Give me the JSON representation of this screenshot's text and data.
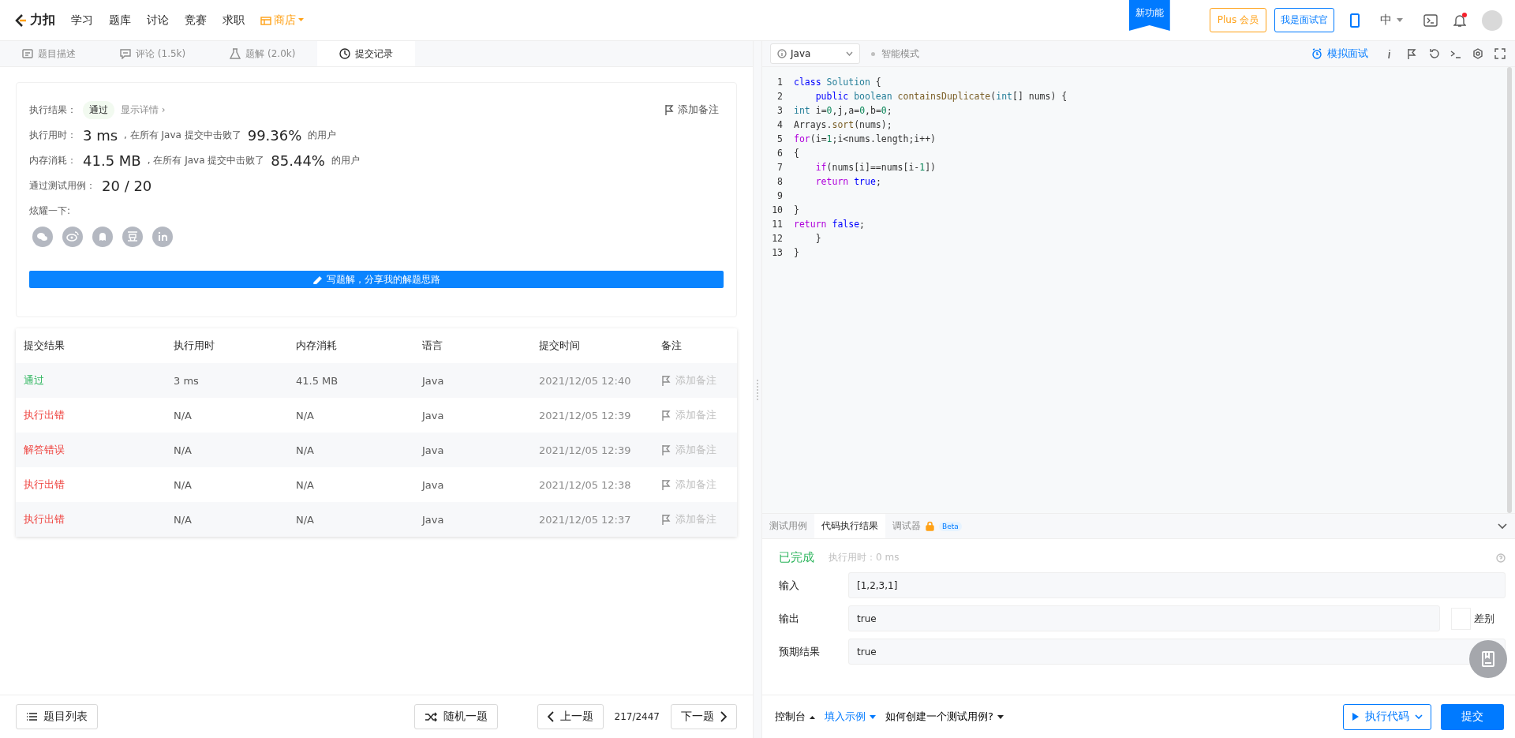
{
  "nav": {
    "logo": "力扣",
    "items": [
      {
        "label": "学习",
        "kind": "link"
      },
      {
        "label": "题库",
        "kind": "link"
      },
      {
        "label": "讨论",
        "kind": "link"
      },
      {
        "label": "竞赛",
        "kind": "link"
      },
      {
        "label": "求职",
        "kind": "link"
      },
      {
        "label": "商店",
        "kind": "shop"
      }
    ],
    "new_feature": "新功能",
    "plus": "Plus 会员",
    "interviewer": "我是面试官",
    "language": "中",
    "unread": true
  },
  "left_tabs": [
    {
      "label": "题目描述",
      "selected": false
    },
    {
      "label": "评论 (1.5k)",
      "selected": false
    },
    {
      "label": "题解 (2.0k)",
      "selected": false
    },
    {
      "label": "提交记录",
      "selected": true
    }
  ],
  "result": {
    "status_label": "执行结果：",
    "status": "通过",
    "details": "显示详情 ›",
    "add_note": "添加备注",
    "stats": [
      {
        "label": "执行用时：",
        "value": "3 ms",
        "text": ", 在所有 Java 提交中击败了",
        "percent": "99.36%",
        "suffix": "的用户"
      },
      {
        "label": "内存消耗：",
        "value": "41.5 MB",
        "text": ", 在所有 Java 提交中击败了",
        "percent": "85.44%",
        "suffix": "的用户"
      }
    ],
    "tests_label": "通过测试用例：",
    "tests": "20 / 20",
    "share_label": "炫耀一下:",
    "write_button": "写题解，分享我的解题思路"
  },
  "table": {
    "columns": [
      "提交结果",
      "执行用时",
      "内存消耗",
      "语言",
      "提交时间",
      "备注"
    ],
    "rows": [
      {
        "result": "通过",
        "kind": "accepted",
        "time": "3 ms",
        "memory": "41.5 MB",
        "language": "Java",
        "submitted": "2021/12/05 12:40",
        "note": "添加备注"
      },
      {
        "result": "执行出错",
        "kind": "error",
        "time": "N/A",
        "memory": "N/A",
        "language": "Java",
        "submitted": "2021/12/05 12:39",
        "note": "添加备注"
      },
      {
        "result": "解答错误",
        "kind": "error",
        "time": "N/A",
        "memory": "N/A",
        "language": "Java",
        "submitted": "2021/12/05 12:39",
        "note": "添加备注"
      },
      {
        "result": "执行出错",
        "kind": "error",
        "time": "N/A",
        "memory": "N/A",
        "language": "Java",
        "submitted": "2021/12/05 12:38",
        "note": "添加备注"
      },
      {
        "result": "执行出错",
        "kind": "error",
        "time": "N/A",
        "memory": "N/A",
        "language": "Java",
        "submitted": "2021/12/05 12:37",
        "note": "添加备注"
      }
    ]
  },
  "left_footer": {
    "list": "题目列表",
    "random": "随机一题",
    "prev": "上一题",
    "position": "217/2447",
    "next": "下一题"
  },
  "editor": {
    "language": "Java",
    "mode": "智能模式",
    "mock": "模拟面试",
    "lines": [
      {
        "number": "1",
        "tokens": [
          {
            "kind": "keyword",
            "text": "class"
          },
          {
            "kind": "type",
            "text": " Solution"
          },
          {
            "kind": "plain",
            "text": " {"
          }
        ]
      },
      {
        "number": "2",
        "tokens": [
          {
            "kind": "keyword",
            "text": "    public"
          },
          {
            "kind": "type",
            "text": " boolean"
          },
          {
            "kind": "func",
            "text": " containsDuplicate"
          },
          {
            "kind": "plain",
            "text": "("
          },
          {
            "kind": "type",
            "text": "int"
          },
          {
            "kind": "plain",
            "text": "[] nums) {"
          }
        ]
      },
      {
        "number": "3",
        "tokens": [
          {
            "kind": "type",
            "text": "int"
          },
          {
            "kind": "plain",
            "text": " i="
          },
          {
            "kind": "number",
            "text": "0"
          },
          {
            "kind": "plain",
            "text": ",j,a="
          },
          {
            "kind": "number",
            "text": "0"
          },
          {
            "kind": "plain",
            "text": ",b="
          },
          {
            "kind": "number",
            "text": "0"
          },
          {
            "kind": "plain",
            "text": ";"
          }
        ]
      },
      {
        "number": "4",
        "tokens": [
          {
            "kind": "plain",
            "text": "Arrays."
          },
          {
            "kind": "func",
            "text": "sort"
          },
          {
            "kind": "plain",
            "text": "(nums);"
          }
        ]
      },
      {
        "number": "5",
        "tokens": [
          {
            "kind": "control",
            "text": "for"
          },
          {
            "kind": "plain",
            "text": "(i="
          },
          {
            "kind": "number",
            "text": "1"
          },
          {
            "kind": "plain",
            "text": ";i<nums.length;i++)"
          }
        ]
      },
      {
        "number": "6",
        "tokens": [
          {
            "kind": "plain",
            "text": "{"
          }
        ]
      },
      {
        "number": "7",
        "tokens": [
          {
            "kind": "control",
            "text": "    if"
          },
          {
            "kind": "plain",
            "text": "(nums[i]==nums[i-"
          },
          {
            "kind": "number",
            "text": "1"
          },
          {
            "kind": "plain",
            "text": "])"
          }
        ]
      },
      {
        "number": "8",
        "tokens": [
          {
            "kind": "control",
            "text": "    return"
          },
          {
            "kind": "keyword",
            "text": " true"
          },
          {
            "kind": "plain",
            "text": ";"
          }
        ]
      },
      {
        "number": "9"
      },
      {
        "number": "10",
        "tokens": [
          {
            "kind": "plain",
            "text": "}"
          }
        ]
      },
      {
        "number": "11",
        "tokens": [
          {
            "kind": "control",
            "text": "return"
          },
          {
            "kind": "keyword",
            "text": " false"
          },
          {
            "kind": "plain",
            "text": ";"
          }
        ]
      },
      {
        "number": "12",
        "tokens": [
          {
            "kind": "plain",
            "text": "    }"
          }
        ]
      },
      {
        "number": "13",
        "tokens": [
          {
            "kind": "plain",
            "text": "}"
          }
        ]
      }
    ]
  },
  "console": {
    "tabs": [
      {
        "label": "测试用例",
        "selected": false
      },
      {
        "label": "代码执行结果",
        "selected": true
      },
      {
        "label": "调试器",
        "selected": false,
        "locked": true,
        "badge": "Beta"
      }
    ],
    "status": "已完成",
    "runtime": "执行用时：0 ms",
    "fields": [
      {
        "label": "输入",
        "value": "[1,2,3,1]"
      },
      {
        "label": "输出",
        "value": "true",
        "diff": "差别"
      },
      {
        "label": "预期结果",
        "value": "true"
      }
    ]
  },
  "right_footer": {
    "console": "控制台",
    "example": "填入示例",
    "howto": "如何创建一个测试用例?",
    "run": "执行代码",
    "submit": "提交"
  }
}
